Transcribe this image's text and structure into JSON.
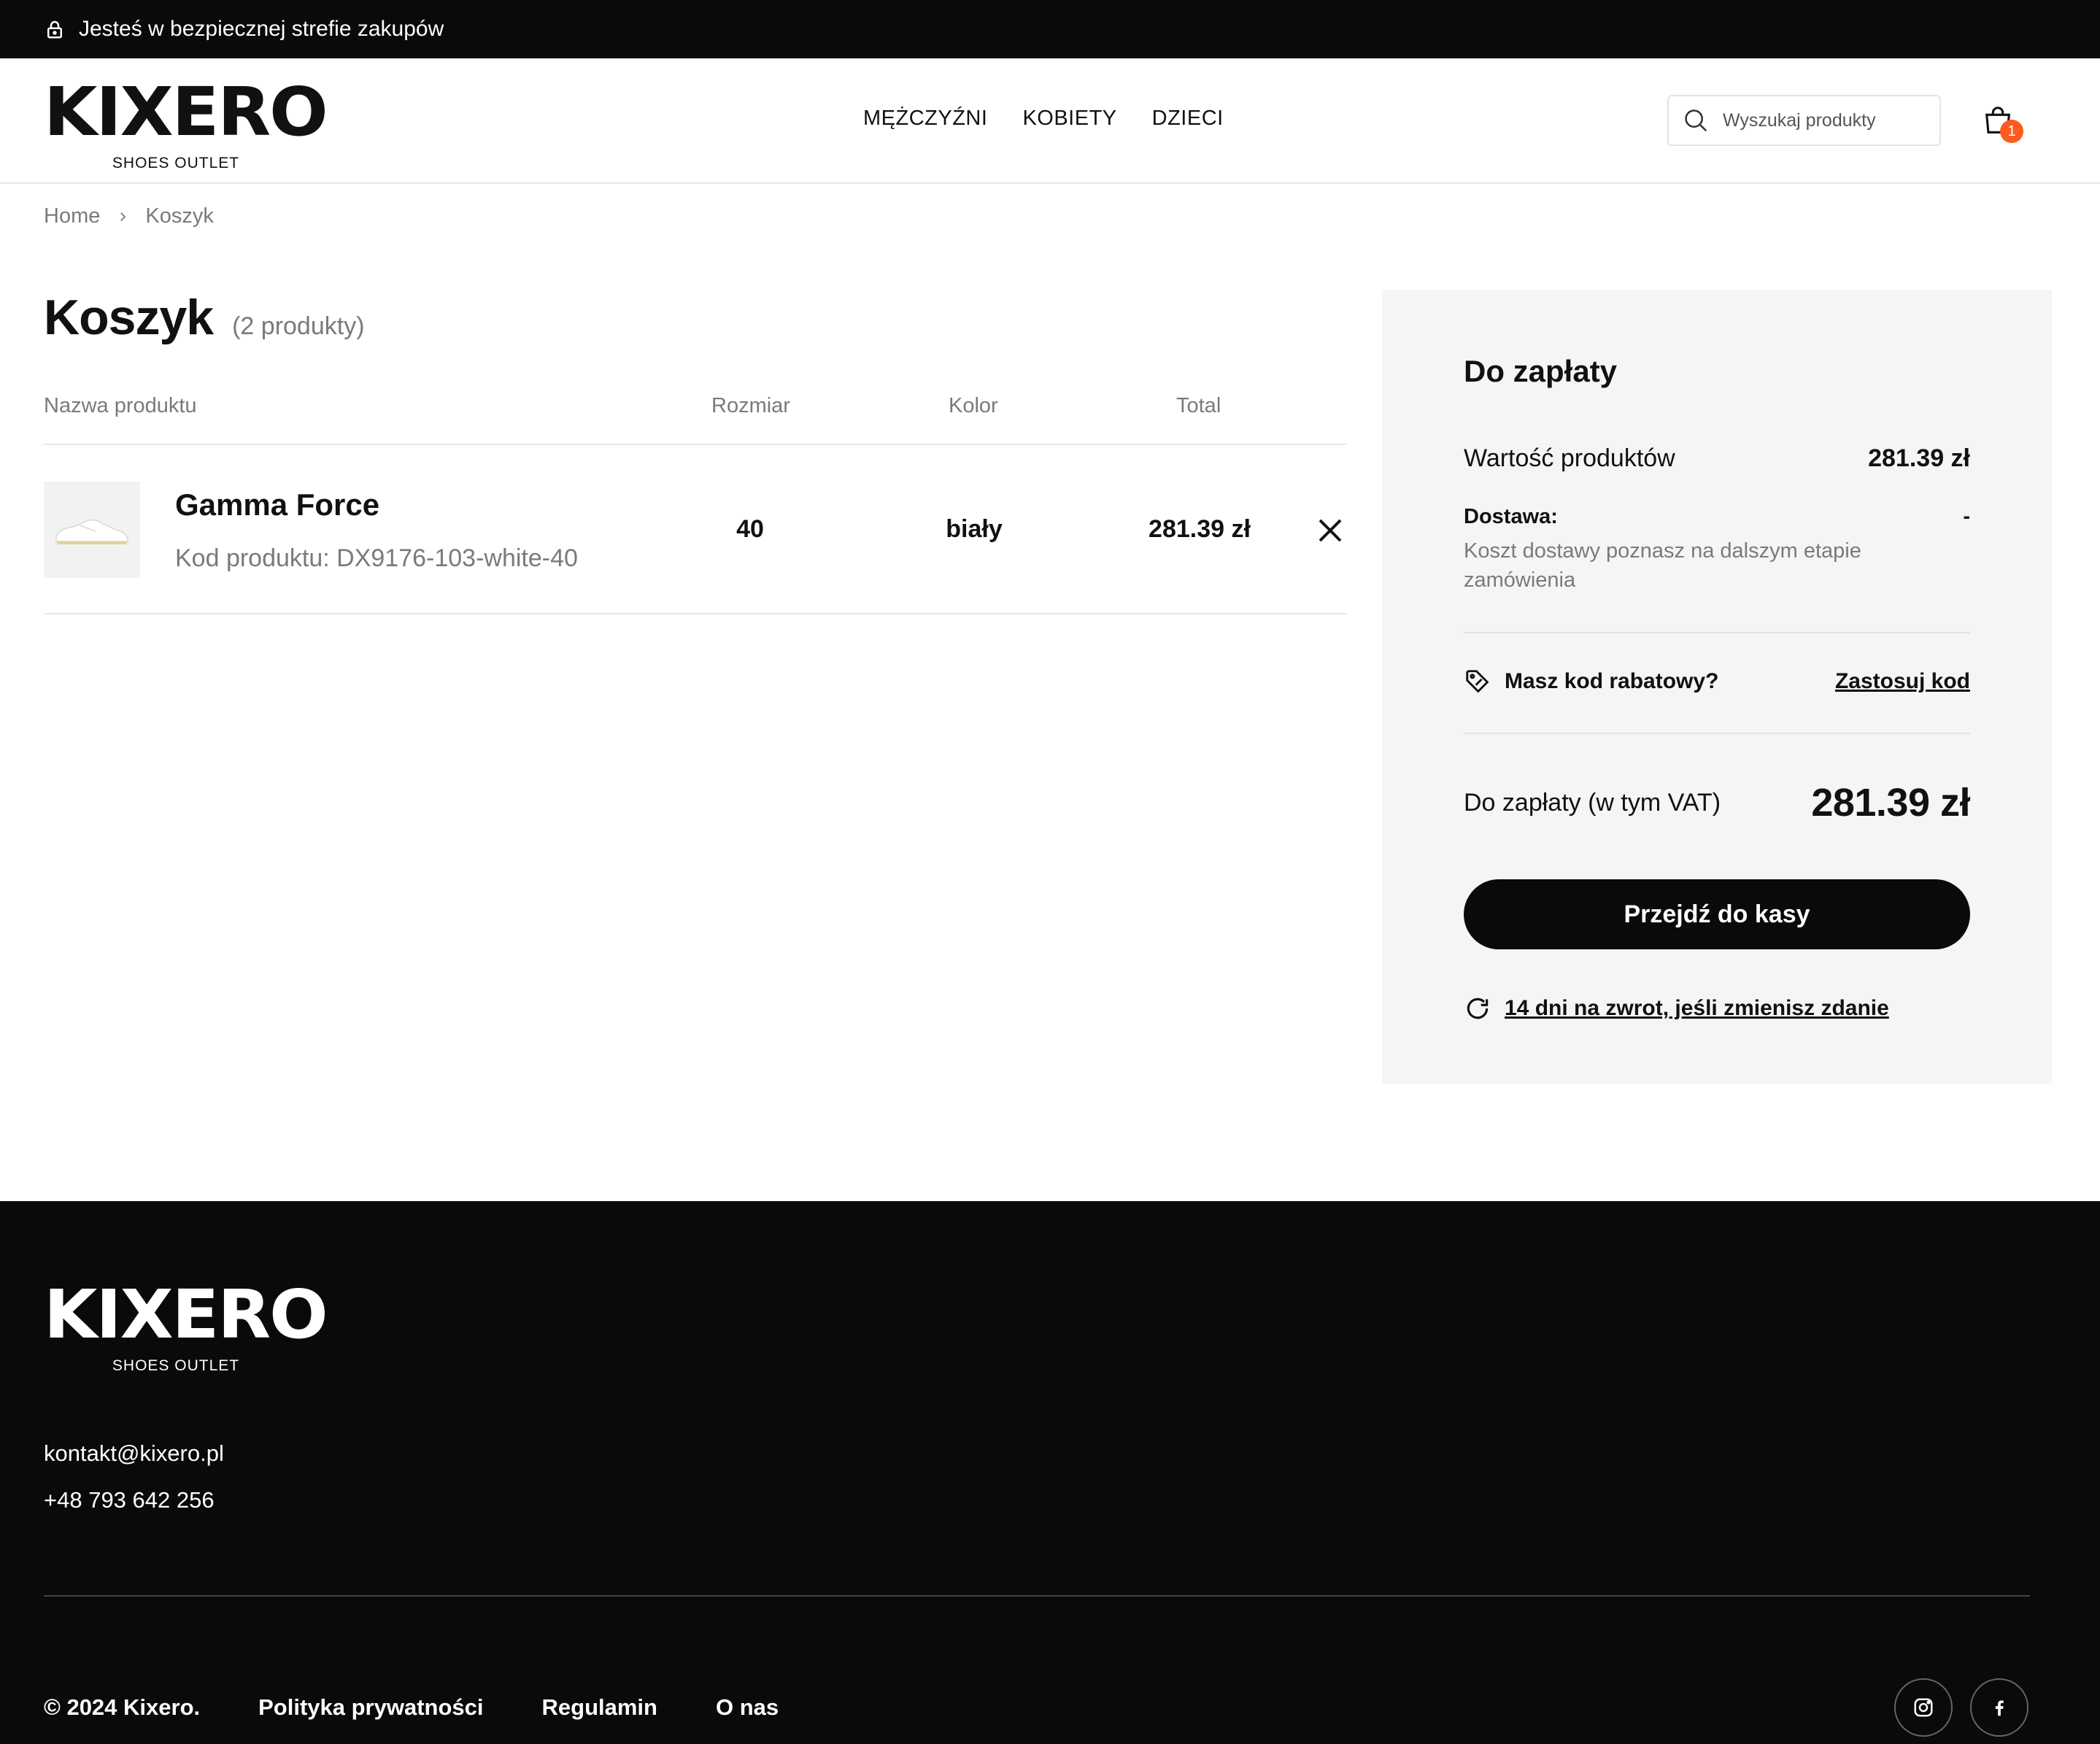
{
  "topbar": {
    "text": "Jesteś w bezpiecznej strefie zakupów",
    "icon": "lock-icon"
  },
  "header": {
    "logo": {
      "word": "KIXERO",
      "subtitle": "SHOES OUTLET"
    },
    "nav": [
      "MĘŻCZYŹNI",
      "KOBIETY",
      "DZIECI"
    ],
    "search_placeholder": "Wyszukaj produkty",
    "cart_badge": "1"
  },
  "breadcrumb": [
    "Home",
    "Koszyk"
  ],
  "cart": {
    "title": "Koszyk",
    "count": "(2 produkty)",
    "columns": {
      "name": "Nazwa produktu",
      "size": "Rozmiar",
      "color": "Kolor",
      "total": "Total"
    },
    "items": [
      {
        "name": "Gamma Force",
        "code": "Kod produktu: DX9176-103-white-40",
        "size": "40",
        "color": "biały",
        "total": "281.39 zł"
      }
    ]
  },
  "summary": {
    "title": "Do zapłaty",
    "products_label": "Wartość produktów",
    "products_value": "281.39 zł",
    "delivery_label": "Dostawa:",
    "delivery_value": "-",
    "delivery_note": "Koszt dostawy poznasz na dalszym etapie zamówienia",
    "promo_label": "Masz kod rabatowy?",
    "promo_action": "Zastosuj kod",
    "total_label": "Do zapłaty (w tym VAT)",
    "total_value": "281.39 zł",
    "checkout_label": "Przejdź do kasy",
    "returns_label": "14 dni na zwrot, jeśli zmienisz zdanie"
  },
  "footer": {
    "logo": {
      "word": "KIXERO",
      "subtitle": "SHOES OUTLET"
    },
    "email": "kontakt@kixero.pl",
    "phone": "+48 793 642 256",
    "copyright": "© 2024 Kixero.",
    "links": [
      "Polityka prywatności",
      "Regulamin",
      "O nas"
    ],
    "social": [
      "instagram-icon",
      "facebook-icon"
    ]
  },
  "colors": {
    "dark": "#0b0a0b",
    "badge": "#ff5a1f",
    "panel": "#f5f5f5",
    "muted": "#7a7a7a"
  }
}
